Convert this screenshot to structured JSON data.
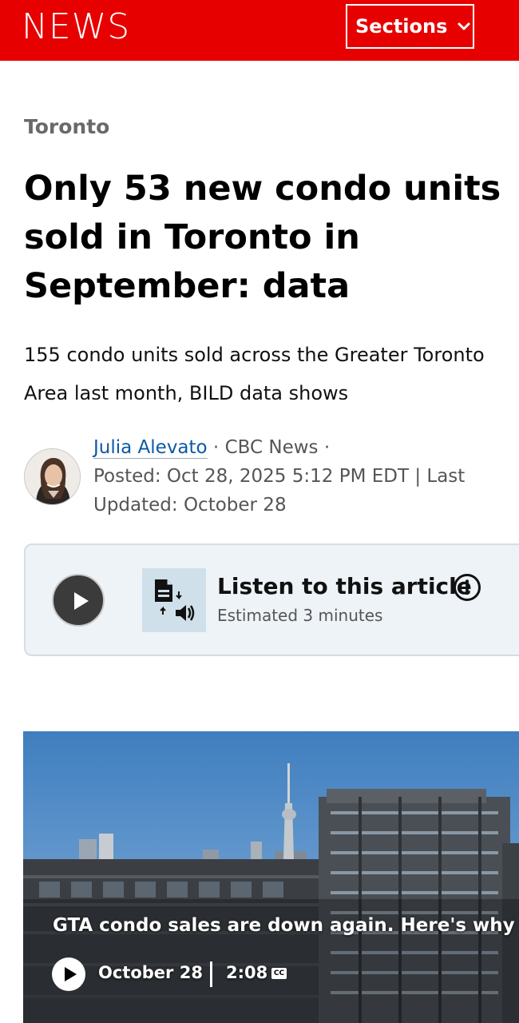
{
  "header": {
    "logo": "NEWS",
    "sections_label": "Sections",
    "brand_color": "#e60000"
  },
  "article": {
    "category": "Toronto",
    "headline": "Only 53 new condo units sold in Toronto in September: data",
    "deck": "155 condo units sold across the Greater Toronto Area last month, BILD data shows",
    "byline": {
      "author": "Julia Alevato",
      "separator_1": " · ",
      "outlet": "CBC News",
      "separator_2": " · ",
      "dates": "Posted: Oct 28, 2025 5:12 PM EDT | Last Updated: October 28"
    }
  },
  "listen": {
    "title": "Listen to this article",
    "subtitle": "Estimated 3 minutes",
    "play_icon": "play-icon",
    "tts_icon": "text-to-speech-icon",
    "info_icon": "info-icon"
  },
  "video": {
    "title": "GTA condo sales are down again. Here's why",
    "date": "October 28",
    "duration": "2:08",
    "cc_label": "CC"
  }
}
